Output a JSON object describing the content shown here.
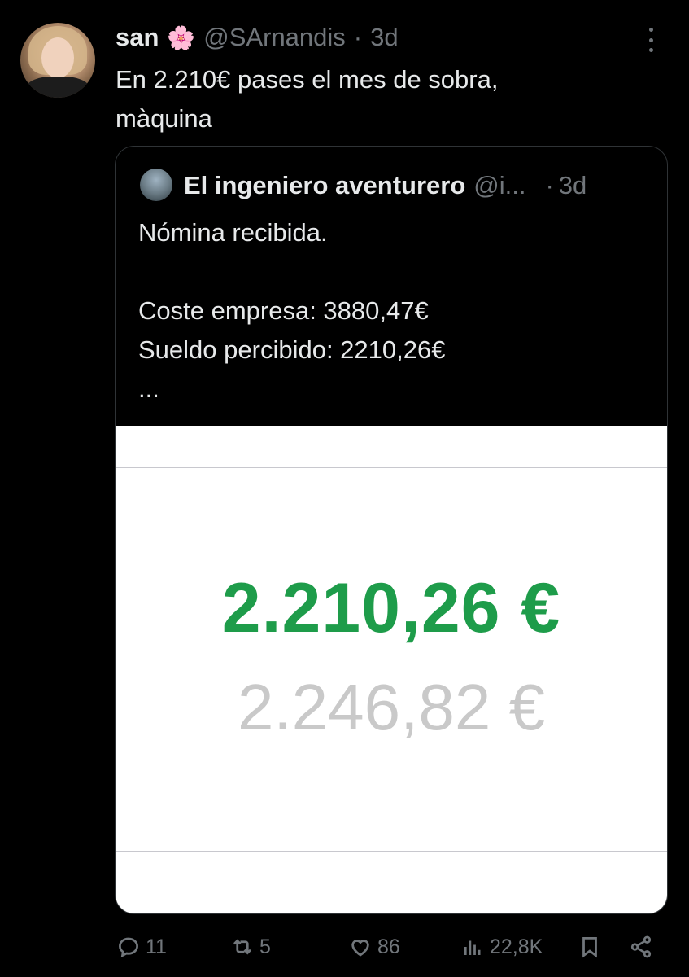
{
  "tweet": {
    "author_name": "san",
    "author_emoji": "🌸",
    "handle": "@SArnandis",
    "separator": "·",
    "time": "3d",
    "text": "En 2.210€ pases el mes de sobra,\nmàquina"
  },
  "quote": {
    "author_name": "El ingeniero aventurero",
    "handle": "@i...",
    "separator": "·",
    "time": "3d",
    "lines": [
      "Nómina recibida.",
      "",
      "Coste empresa: 3880,47€",
      "Sueldo percibido: 2210,26€",
      "..."
    ],
    "image": {
      "amount_main": "2.210,26 €",
      "amount_secondary": "2.246,82 €",
      "main_color": "#1e9c4a",
      "secondary_color": "#c9c9c9"
    }
  },
  "actions": {
    "replies": "11",
    "reposts": "5",
    "likes": "86",
    "views": "22,8K"
  },
  "icons": [
    "more-icon",
    "reply-icon",
    "repost-icon",
    "like-icon",
    "views-icon",
    "bookmark-icon",
    "share-icon"
  ]
}
